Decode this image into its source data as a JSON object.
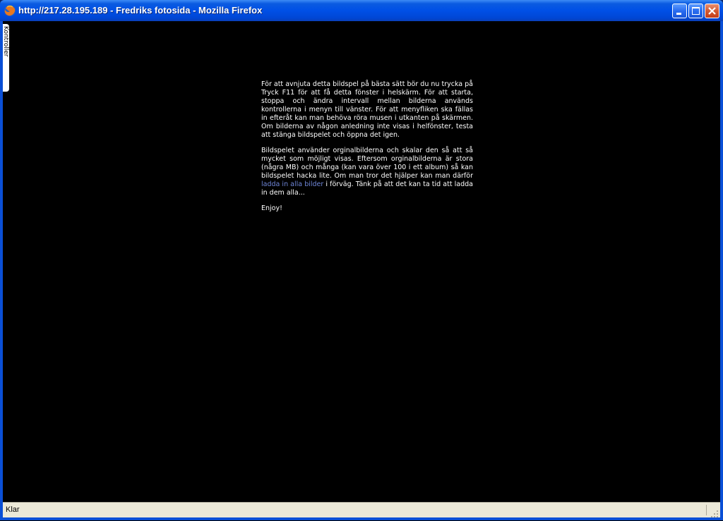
{
  "window": {
    "title": "http://217.28.195.189 - Fredriks fotosida - Mozilla Firefox",
    "app_icon": "firefox-icon",
    "controls": [
      "minimize-icon",
      "maximize-icon",
      "close-icon"
    ]
  },
  "sidebar": {
    "tab_label": "Kontroller"
  },
  "main": {
    "paragraph1": "För att avnjuta detta bildspel på bästa sätt bör du nu trycka på Tryck F11 för att få detta fönster i helskärm. För att starta, stoppa och ändra intervall mellan bilderna används kontrollerna i menyn till vänster. För att menyfliken ska fällas in efteråt kan man behöva röra musen i utkanten på skärmen. Om bilderna av någon anledning inte visas i helfönster, testa att stänga bildspelet och öppna det igen.",
    "paragraph2_before": "Bildspelet använder orginalbilderna och skalar den så att så mycket som möjligt visas. Eftersom orginalbilderna är stora (några MB) och många (kan vara över 100 i ett album) så kan bildspelet hacka lite. Om man tror det hjälper kan man därför ",
    "paragraph2_link": "ladda in alla bilder",
    "paragraph2_after": " i förväg. Tänk på att det kan ta tid att ladda in dem alla...",
    "paragraph3": "Enjoy!"
  },
  "statusbar": {
    "text": "Klar"
  },
  "colors": {
    "link": "#6f86d8",
    "background": "#000000",
    "text": "#ffffff"
  }
}
